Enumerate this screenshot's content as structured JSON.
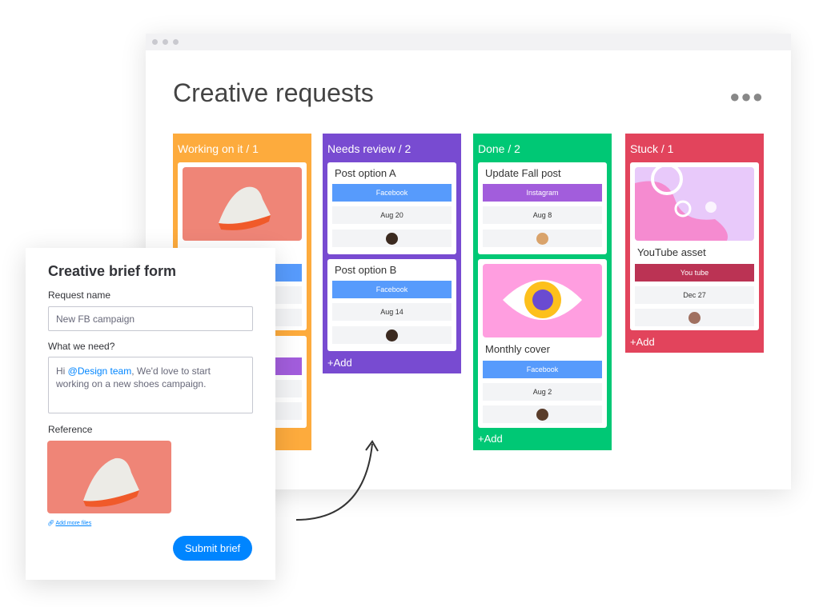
{
  "board": {
    "title": "Creative requests",
    "more_icon": "more-horizontal-icon",
    "columns": [
      {
        "header": "Working on it / 1",
        "color": "#fdab3d"
      },
      {
        "header": "Needs review / 2",
        "color": "#784bd1",
        "add": "+Add",
        "cards": [
          {
            "title": "Post option A",
            "tag": "Facebook",
            "date": "Aug 20"
          },
          {
            "title": "Post option B",
            "tag": "Facebook",
            "date": "Aug 14"
          }
        ]
      },
      {
        "header": "Done / 2",
        "color": "#00c875",
        "add": "+Add",
        "cards": [
          {
            "title": "Update Fall post",
            "tag": "Instagram",
            "date": "Aug 8"
          },
          {
            "title": "Monthly cover",
            "tag": "Facebook",
            "date": "Aug 2"
          }
        ]
      },
      {
        "header": "Stuck / 1",
        "color": "#e2445c",
        "add": "+Add",
        "cards": [
          {
            "title": "YouTube asset",
            "tag": "You tube",
            "date": "Dec 27"
          }
        ]
      }
    ]
  },
  "tag_colors": {
    "Facebook": "#579bfc",
    "Instagram": "#a25ddc",
    "You tube": "#bb3354"
  },
  "form": {
    "title": "Creative brief form",
    "request_label": "Request name",
    "request_value": "New FB campaign",
    "need_label": "What we need?",
    "need_prefix": "Hi ",
    "need_mention": "@Design team",
    "need_rest": ", We'd love to start working on a new shoes campaign.",
    "reference_label": "Reference",
    "add_files": "Add more files",
    "submit": "Submit brief"
  }
}
